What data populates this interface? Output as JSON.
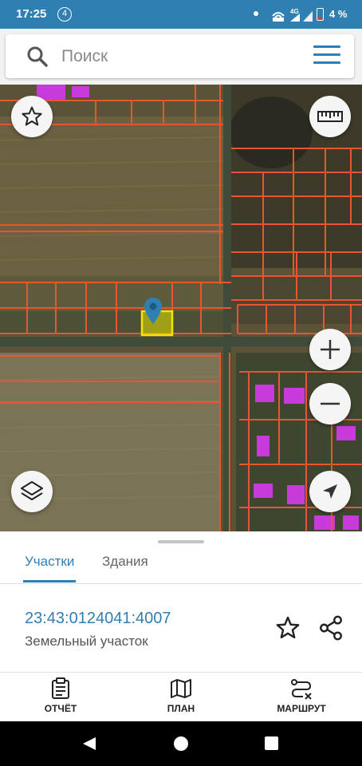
{
  "status_bar": {
    "time": "17:25",
    "notification_count": "4",
    "network": "4G",
    "battery_percent": "4 %"
  },
  "search": {
    "placeholder": "Поиск",
    "value": ""
  },
  "map": {
    "buttons": [
      "star-icon",
      "ruler-icon",
      "zoom-in-icon",
      "zoom-out-icon",
      "layers-icon",
      "navigation-arrow-icon"
    ],
    "colors": {
      "parcel_border": "#e8552f",
      "selected_parcel": "#f5e400",
      "building": "#c63bd9",
      "pin": "#2f7fb3"
    }
  },
  "sheet": {
    "tabs": [
      {
        "label": "Участки",
        "active": true
      },
      {
        "label": "Здания",
        "active": false
      }
    ],
    "cadastral_number": "23:43:0124041:4007",
    "parcel_type": "Земельный участок"
  },
  "bottom_nav": {
    "items": [
      {
        "label": "ОТЧЁТ",
        "icon": "clipboard-icon"
      },
      {
        "label": "ПЛАН",
        "icon": "map-icon"
      },
      {
        "label": "МАРШРУТ",
        "icon": "route-icon"
      }
    ]
  },
  "theme": {
    "accent": "#2f7fb3"
  }
}
